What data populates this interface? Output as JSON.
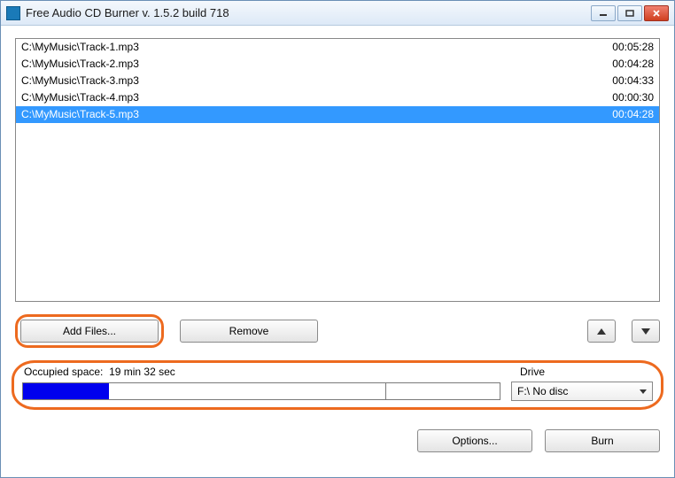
{
  "window": {
    "title": "Free Audio CD Burner  v. 1.5.2 build 718"
  },
  "files": [
    {
      "path": "C:\\MyMusic\\Track-1.mp3",
      "duration": "00:05:28",
      "selected": false
    },
    {
      "path": "C:\\MyMusic\\Track-2.mp3",
      "duration": "00:04:28",
      "selected": false
    },
    {
      "path": "C:\\MyMusic\\Track-3.mp3",
      "duration": "00:04:33",
      "selected": false
    },
    {
      "path": "C:\\MyMusic\\Track-4.mp3",
      "duration": "00:00:30",
      "selected": false
    },
    {
      "path": "C:\\MyMusic\\Track-5.mp3",
      "duration": "00:04:28",
      "selected": true
    }
  ],
  "buttons": {
    "add_files": "Add Files...",
    "remove": "Remove",
    "options": "Options...",
    "burn": "Burn"
  },
  "occupied": {
    "label": "Occupied space:",
    "value": "19 min 32 sec",
    "fill_percent": 18,
    "tick_percent": 76
  },
  "drive": {
    "label": "Drive",
    "selected": "F:\\ No disc"
  }
}
